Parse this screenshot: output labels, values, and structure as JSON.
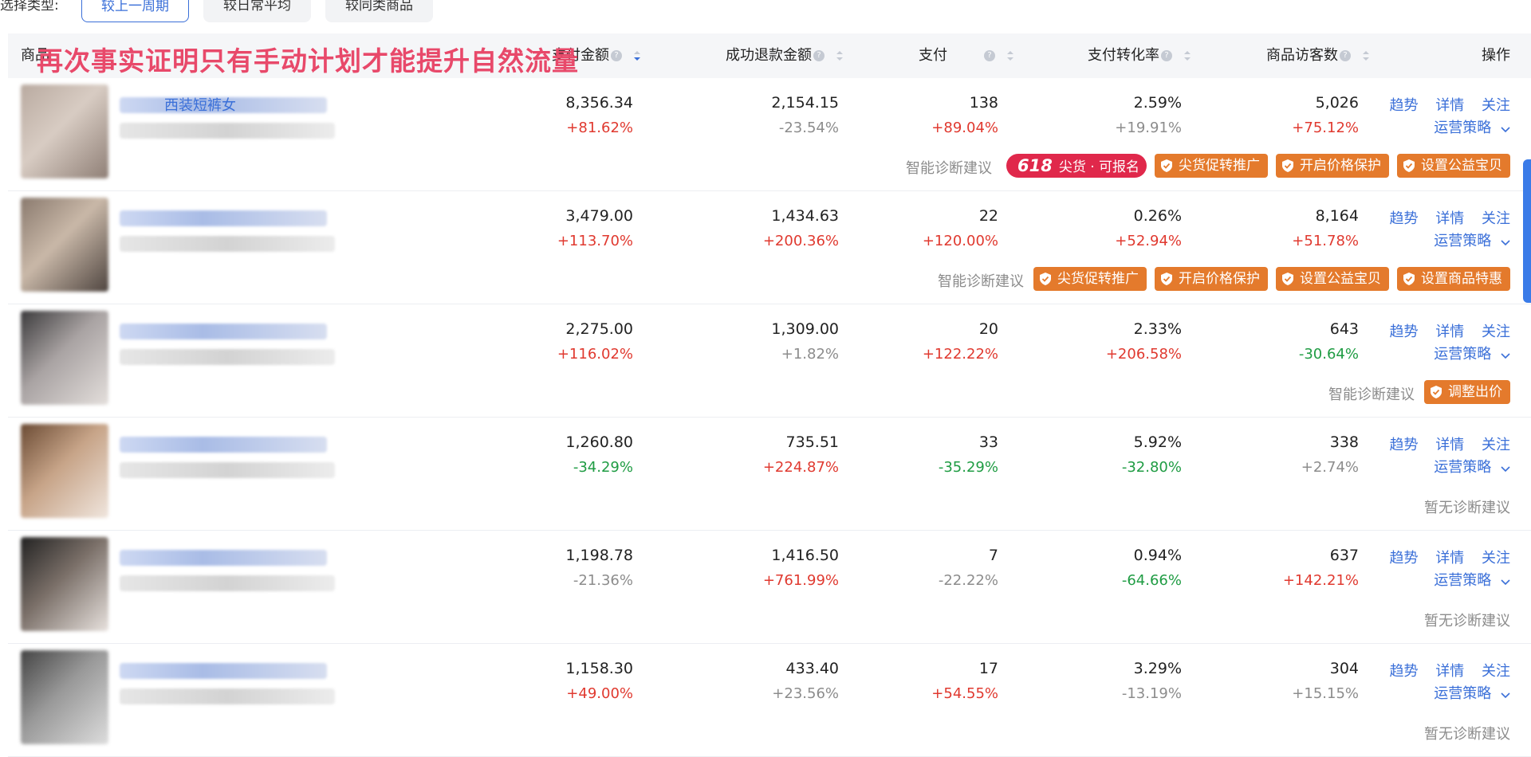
{
  "filter": {
    "label": "选择类型:",
    "options": [
      "较上一周期",
      "较日常平均",
      "较同类商品"
    ]
  },
  "overlay_title": "再次事实证明只有手动计划才能提升自然流量",
  "columns": {
    "product": "商品",
    "pay_amount": "支付金额",
    "refund_amount": "成功退款金额",
    "pay_count": "支付",
    "conversion": "支付转化率",
    "visitors": "商品访客数",
    "ops": "操作"
  },
  "ops_labels": {
    "trend": "趋势",
    "detail": "详情",
    "follow": "关注",
    "strategy": "运营策略"
  },
  "diagnosis_label": "智能诊断建议",
  "no_diagnosis": "暂无诊断建议",
  "tag618_main": "618",
  "tag618_text": "尖货 · 可报名",
  "rows": [
    {
      "name": "西装短裤女",
      "pay_amount": "8,356.34",
      "pay_amount_change": "+81.62%",
      "pay_amount_color": "red",
      "refund": "2,154.15",
      "refund_change": "-23.54%",
      "refund_color": "gray",
      "count": "138",
      "count_change": "+89.04%",
      "count_color": "red",
      "conv": "2.59%",
      "conv_change": "+19.91%",
      "conv_color": "gray",
      "visitors": "5,026",
      "visitors_change": "+75.12%",
      "visitors_color": "red",
      "tags": [
        "尖货促转推广",
        "开启价格保护",
        "设置公益宝贝"
      ]
    },
    {
      "name": "",
      "pay_amount": "3,479.00",
      "pay_amount_change": "+113.70%",
      "pay_amount_color": "red",
      "refund": "1,434.63",
      "refund_change": "+200.36%",
      "refund_color": "red",
      "count": "22",
      "count_change": "+120.00%",
      "count_color": "red",
      "conv": "0.26%",
      "conv_change": "+52.94%",
      "conv_color": "red",
      "visitors": "8,164",
      "visitors_change": "+51.78%",
      "visitors_color": "red",
      "tags": [
        "尖货促转推广",
        "开启价格保护",
        "设置公益宝贝",
        "设置商品特惠"
      ]
    },
    {
      "name": "",
      "pay_amount": "2,275.00",
      "pay_amount_change": "+116.02%",
      "pay_amount_color": "red",
      "refund": "1,309.00",
      "refund_change": "+1.82%",
      "refund_color": "gray",
      "count": "20",
      "count_change": "+122.22%",
      "count_color": "red",
      "conv": "2.33%",
      "conv_change": "+206.58%",
      "conv_color": "red",
      "visitors": "643",
      "visitors_change": "-30.64%",
      "visitors_color": "green",
      "tags": [
        "调整出价"
      ]
    },
    {
      "name": "",
      "pay_amount": "1,260.80",
      "pay_amount_change": "-34.29%",
      "pay_amount_color": "green",
      "refund": "735.51",
      "refund_change": "+224.87%",
      "refund_color": "red",
      "count": "33",
      "count_change": "-35.29%",
      "count_color": "green",
      "conv": "5.92%",
      "conv_change": "-32.80%",
      "conv_color": "green",
      "visitors": "338",
      "visitors_change": "+2.74%",
      "visitors_color": "gray",
      "tags": []
    },
    {
      "name": "",
      "pay_amount": "1,198.78",
      "pay_amount_change": "-21.36%",
      "pay_amount_color": "gray",
      "refund": "1,416.50",
      "refund_change": "+761.99%",
      "refund_color": "red",
      "count": "7",
      "count_change": "-22.22%",
      "count_color": "gray",
      "conv": "0.94%",
      "conv_change": "-64.66%",
      "conv_color": "green",
      "visitors": "637",
      "visitors_change": "+142.21%",
      "visitors_color": "red",
      "tags": []
    },
    {
      "name": "",
      "pay_amount": "1,158.30",
      "pay_amount_change": "+49.00%",
      "pay_amount_color": "red",
      "refund": "433.40",
      "refund_change": "+23.56%",
      "refund_color": "gray",
      "count": "17",
      "count_change": "+54.55%",
      "count_color": "red",
      "conv": "3.29%",
      "conv_change": "-13.19%",
      "conv_color": "gray",
      "visitors": "304",
      "visitors_change": "+15.15%",
      "visitors_color": "gray",
      "tags": []
    }
  ]
}
